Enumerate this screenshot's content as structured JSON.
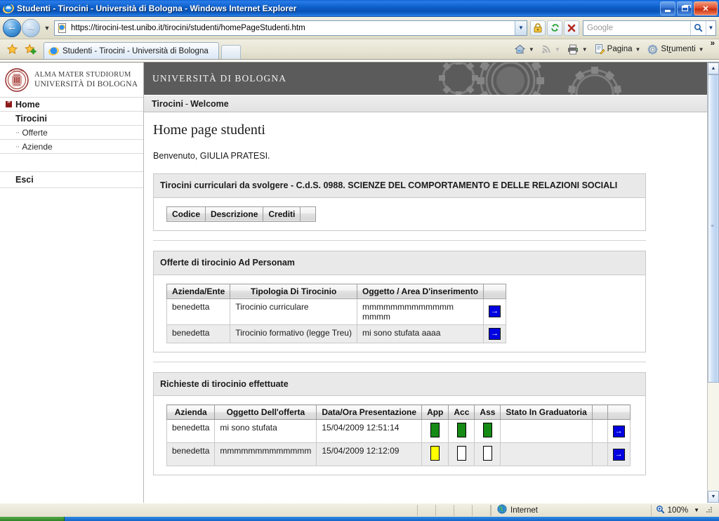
{
  "window": {
    "title": "Studenti - Tirocini - Università di Bologna - Windows Internet Explorer",
    "minimize_label": "Minimize",
    "maximize_label": "Maximize",
    "close_label": "Close"
  },
  "toolbar": {
    "back_glyph": "←",
    "forward_glyph": "→",
    "history_caret": "▼",
    "url": "https://tirocini-test.unibo.it/tirocini/studenti/homePageStudenti.htm",
    "url_dropdown_glyph": "▼",
    "lock_title": "SSL secure",
    "refresh_title": "Refresh",
    "stop_title": "Stop",
    "search_placeholder": "Google",
    "search_dropdown_glyph": "▼"
  },
  "tabs": {
    "favorites_title": "Favorites Center",
    "add_favorites_title": "Add to Favorites",
    "items": [
      {
        "label": "Studenti - Tirocini - Università di Bologna",
        "active": true
      }
    ],
    "new_tab_title": "New Tab"
  },
  "commandbar": {
    "home_label": "Home",
    "feeds_label": "Feeds",
    "print_label": "Print",
    "page_label": "Pagina",
    "page_accesskey": "g",
    "tools_label": "Strumenti",
    "tools_accesskey": "r",
    "caret": "▼",
    "overflow": "»"
  },
  "sidebar": {
    "crest": {
      "line1": "ALMA MATER STUDIORUM",
      "line2": "UNIVERSITÀ DI BOLOGNA"
    },
    "items": [
      {
        "label": "Home",
        "level": "home"
      },
      {
        "label": "Tirocini",
        "level": "lvl1"
      },
      {
        "label": "Offerte",
        "level": "lvl2",
        "bullet": "··"
      },
      {
        "label": "Aziende",
        "level": "lvl2",
        "bullet": "··"
      },
      {
        "label": "Esci",
        "level": "esci"
      }
    ]
  },
  "banner": {
    "title": "UNIVERSITÀ DI BOLOGNA"
  },
  "breadcrumb": {
    "root": "Tirocini",
    "separator": "-",
    "current": "Welcome"
  },
  "page": {
    "title": "Home page studenti",
    "welcome": "Benvenuto, GIULIA PRATESI."
  },
  "panels": [
    {
      "id": "tirocini-curriculari",
      "heading": "Tirocini curriculari da svolgere - C.d.S. 0988. SCIENZE DEL COMPORTAMENTO E DELLE RELAZIONI SOCIALI",
      "columns": [
        "Codice",
        "Descrizione",
        "Crediti"
      ],
      "rows": []
    },
    {
      "id": "offerte-ad-personam",
      "heading": "Offerte di tirocinio Ad Personam",
      "columns": [
        "Azienda/Ente",
        "Tipologia Di Tirocinio",
        "Oggetto / Area D'inserimento"
      ],
      "rows": [
        {
          "azienda": "benedetta",
          "tipologia": "Tirocinio curriculare",
          "oggetto": "mmmmmmmmmmmmm mmmm",
          "action": "→"
        },
        {
          "azienda": "benedetta",
          "tipologia": "Tirocinio formativo (legge Treu)",
          "oggetto": "mi sono stufata aaaa",
          "action": "→"
        }
      ]
    },
    {
      "id": "richieste-effettuate",
      "heading": "Richieste di tirocinio effettuate",
      "columns": [
        "Azienda",
        "Oggetto Dell'offerta",
        "Data/Ora Presentazione",
        "App",
        "Acc",
        "Ass",
        "Stato In Graduatoria"
      ],
      "rows": [
        {
          "azienda": "benedetta",
          "oggetto": "mi sono stufata",
          "data": "15/04/2009 12:51:14",
          "app": "green",
          "acc": "green",
          "ass": "green",
          "stato": "",
          "action": "→"
        },
        {
          "azienda": "benedetta",
          "oggetto": "mmmmmmmmmmmmm",
          "data": "15/04/2009 12:12:09",
          "app": "yellow",
          "acc": "white",
          "ass": "white",
          "stato": "",
          "action": "→"
        }
      ]
    }
  ],
  "scrollbar": {
    "up_glyph": "▲",
    "down_glyph": "▼"
  },
  "statusbar": {
    "zone": "Internet",
    "zoom": "100%",
    "zoom_caret": "▼"
  }
}
